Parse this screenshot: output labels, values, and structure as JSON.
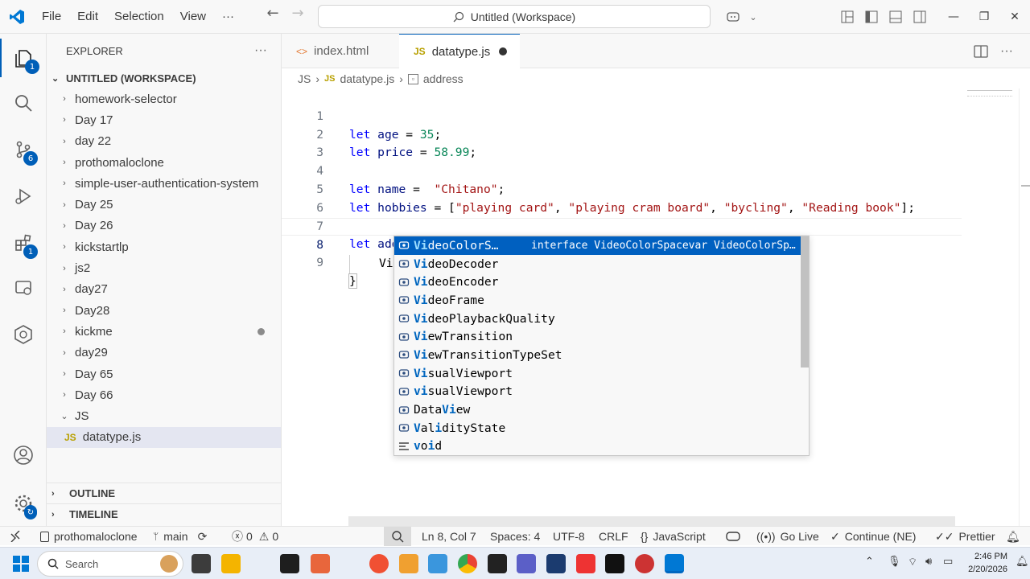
{
  "menu": {
    "file": "File",
    "edit": "Edit",
    "selection": "Selection",
    "view": "View",
    "more": "···"
  },
  "search": {
    "label": "Untitled (Workspace)"
  },
  "activity": {
    "explorer_badge": "1",
    "scm_badge": "6",
    "ext_badge": "1"
  },
  "sidebar": {
    "title": "EXPLORER",
    "workspace": "UNTITLED (WORKSPACE)",
    "folders": [
      {
        "label": "homework-selector"
      },
      {
        "label": "Day 17"
      },
      {
        "label": "day 22"
      },
      {
        "label": "prothomaloclone"
      },
      {
        "label": "simple-user-authentication-system"
      },
      {
        "label": "Day 25"
      },
      {
        "label": "Day 26"
      },
      {
        "label": "kickstartlp"
      },
      {
        "label": "js2"
      },
      {
        "label": "day27"
      },
      {
        "label": "Day28"
      },
      {
        "label": "kickme"
      },
      {
        "label": "day29"
      },
      {
        "label": "Day 65"
      },
      {
        "label": "Day 66"
      },
      {
        "label": "JS"
      }
    ],
    "file": "datatype.js",
    "file_icon": "JS",
    "outline": "OUTLINE",
    "timeline": "TIMELINE"
  },
  "tabs": [
    {
      "icon": "<>",
      "label": "index.html"
    },
    {
      "icon": "JS",
      "label": "datatype.js"
    }
  ],
  "breadcrumb": {
    "folder": "JS",
    "file": "datatype.js",
    "symbol": "address",
    "file_icon": "JS"
  },
  "code": {
    "l1": {
      "kw": "let",
      "name": "age",
      "op": " = ",
      "val": "35",
      "end": ";"
    },
    "l2": {
      "kw": "let",
      "name": "price",
      "op": " = ",
      "val": "58.99",
      "end": ";"
    },
    "l4": {
      "kw": "let",
      "name": "name",
      "op": " =  ",
      "val": "\"Chitano\"",
      "end": ";"
    },
    "l5": {
      "kw": "let",
      "name": "hobbies",
      "op": " = [",
      "s1": "\"playing card\"",
      "s2": "\"playing cram board\"",
      "s3": "\"bycling\"",
      "s4": "\"Reading book\"",
      "end": "];",
      "sep": ", "
    },
    "l7": {
      "kw": "let",
      "name": "address",
      "op": " = ",
      "brace": "{"
    },
    "l8": {
      "typed": "Vi"
    },
    "l9": {
      "brace": "}"
    },
    "line_numbers": [
      "1",
      "2",
      "3",
      "4",
      "5",
      "6",
      "7",
      "8",
      "9"
    ]
  },
  "suggest": {
    "items": [
      {
        "hl": "Vi",
        "rest": "deoColorS…",
        "detail": "interface VideoColorSpacevar VideoColorSp…"
      },
      {
        "hl": "Vi",
        "rest": "deoDecoder"
      },
      {
        "hl": "Vi",
        "rest": "deoEncoder"
      },
      {
        "hl": "Vi",
        "rest": "deoFrame"
      },
      {
        "hl": "Vi",
        "rest": "deoPlaybackQuality"
      },
      {
        "hl": "Vi",
        "rest": "ewTransition"
      },
      {
        "hl": "Vi",
        "rest": "ewTransitionTypeSet"
      },
      {
        "hl": "Vi",
        "rest": "sualViewport"
      },
      {
        "hl": "vi",
        "rest": "sualViewport"
      },
      {
        "pre": "Data",
        "hl": "Vi",
        "rest": "ew"
      },
      {
        "pre": "",
        "hl": "V",
        "mid": "al",
        "hl2": "i",
        "rest": "dityState"
      },
      {
        "pre": "",
        "hl": "v",
        "mid": "o",
        "hl2": "i",
        "rest": "d"
      }
    ]
  },
  "status": {
    "remote": "⨯",
    "branch_repo": "prothomaloclone",
    "branch": "main",
    "errors": "0",
    "warnings": "0",
    "position": "Ln 8, Col 7",
    "spaces": "Spaces: 4",
    "encoding": "UTF-8",
    "eol": "CRLF",
    "language": "JavaScript",
    "golive": "Go Live",
    "continue": "Continue (NE)",
    "prettier": "Prettier"
  },
  "taskbar": {
    "search": "Search",
    "time": "2:46 PM",
    "date": "2/20/2026"
  }
}
